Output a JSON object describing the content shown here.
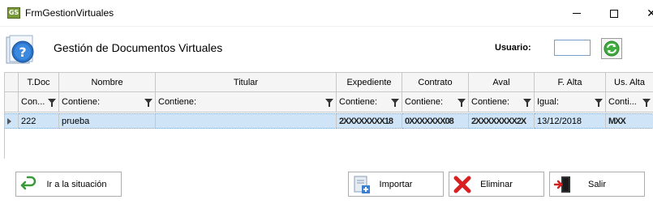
{
  "window": {
    "title": "FrmGestionVirtuales",
    "app_icon_text": "GS"
  },
  "header": {
    "title": "Gestión de Documentos Virtuales",
    "user_label": "Usuario:",
    "user_value": ""
  },
  "grid": {
    "columns": [
      {
        "header": "T.Doc",
        "filter": "Con..."
      },
      {
        "header": "Nombre",
        "filter": "Contiene:"
      },
      {
        "header": "Titular",
        "filter": "Contiene:"
      },
      {
        "header": "Expediente",
        "filter": "Contiene:"
      },
      {
        "header": "Contrato",
        "filter": "Contiene:"
      },
      {
        "header": "Aval",
        "filter": "Contiene:"
      },
      {
        "header": "F. Alta",
        "filter": "Igual:"
      },
      {
        "header": "Us. Alta",
        "filter": "Conti..."
      }
    ],
    "rows": [
      {
        "tdoc": "222",
        "nombre": "prueba",
        "titular": "",
        "expediente": "2XXXXXXXX18",
        "contrato": "0XXXXXXX08",
        "aval": "2XXXXXXXX2X",
        "f_alta": "13/12/2018",
        "us_alta": "MXX"
      }
    ]
  },
  "buttons": {
    "situacion": "Ir a la situación",
    "importar": "Importar",
    "eliminar": "Eliminar",
    "salir": "Salir"
  },
  "colors": {
    "selected_row": "#cfe4f7",
    "header_bg": "#f5f5f5",
    "accent_green": "#2e9e2e",
    "delete_red": "#d92020"
  }
}
